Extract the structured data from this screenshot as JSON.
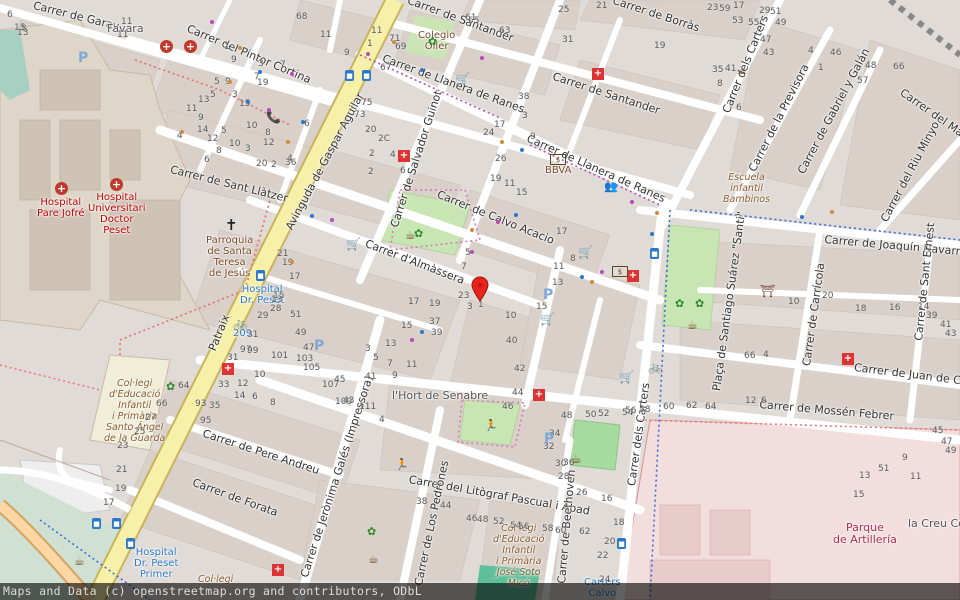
{
  "map": {
    "streets": [
      {
        "id": "garay",
        "name": "Carrer de Garay"
      },
      {
        "id": "pintor",
        "name": "Carrer del Pintor Cortina"
      },
      {
        "id": "gaspar",
        "name": "Avinguda de Gaspar Aguilar"
      },
      {
        "id": "santander1",
        "name": "Carrer de Santander"
      },
      {
        "id": "santander2",
        "name": "Carrer de Santander"
      },
      {
        "id": "borras",
        "name": "Carrer de Borràs"
      },
      {
        "id": "llanera1",
        "name": "Carrer de Llanera de Ranes"
      },
      {
        "id": "llanera2",
        "name": "Carrer de Llanera de Ranes"
      },
      {
        "id": "carters_top",
        "name": "Carrer dels Carters"
      },
      {
        "id": "previsora",
        "name": "Carrer de la Previsora"
      },
      {
        "id": "gabriel",
        "name": "Carrer de Gabriel y Galán"
      },
      {
        "id": "marques",
        "name": "Carrer del Marqu"
      },
      {
        "id": "rumiquel",
        "name": "Carrer del Riu Minyo"
      },
      {
        "id": "llatzer",
        "name": "Carrer de Sant Llàtzer"
      },
      {
        "id": "guinot",
        "name": "Carrer de Salvador Guinot"
      },
      {
        "id": "calvo",
        "name": "Carrer de Calvo Acacio"
      },
      {
        "id": "almassera",
        "name": "Carrer d'Almàssera"
      },
      {
        "id": "joaquin",
        "name": "Carrer de Joaquín Navarro"
      },
      {
        "id": "santiago",
        "name": "Plaça de Santiago Suárez \"Santi\""
      },
      {
        "id": "carricola",
        "name": "Carrer de Carrícola"
      },
      {
        "id": "sant_ernest",
        "name": "Carrer de Sant Ernest"
      },
      {
        "id": "juan",
        "name": "Carrer de Juan de Ce"
      },
      {
        "id": "mossen",
        "name": "Carrer de Mossén Febrer"
      },
      {
        "id": "carters",
        "name": "Carrer dels Carters"
      },
      {
        "id": "pere",
        "name": "Carrer de Pere Andreu"
      },
      {
        "id": "forata",
        "name": "Carrer de Forata"
      },
      {
        "id": "jeronima",
        "name": "Carrer de Jerònima Galés (Impressora)"
      },
      {
        "id": "litograf",
        "name": "Carrer del Litògraf Pascual i Abad"
      },
      {
        "id": "pedrones",
        "name": "Carrer de Los Pedrones"
      },
      {
        "id": "beethoven",
        "name": "Carrer de Beethoven"
      },
      {
        "id": "ramal",
        "name": "Patraix"
      }
    ],
    "places": [
      {
        "id": "favara",
        "text": "Favara",
        "kind": "plain"
      },
      {
        "id": "colegio_oller",
        "text": "Colegio\nOller",
        "kind": "poi"
      },
      {
        "id": "bbva",
        "text": "BBVA",
        "kind": "poi"
      },
      {
        "id": "escuela",
        "text": "Escuela\ninfantil\nBambinos",
        "kind": "school"
      },
      {
        "id": "hosp_jofre",
        "text": "Hospital\nPare Jofré",
        "kind": "hosp"
      },
      {
        "id": "hosp_peset",
        "text": "Hospital\nUniversitari\nDoctor\nPeset",
        "kind": "hosp"
      },
      {
        "id": "parroquia",
        "text": "Parroquia\nde Santa\nTeresa\nde Jesús",
        "kind": "poi"
      },
      {
        "id": "bus_peset",
        "text": "Hospital\nDr. Peset",
        "kind": "bus"
      },
      {
        "id": "bike_209",
        "text": "209",
        "kind": "bus"
      },
      {
        "id": "sant_angel",
        "text": "Col·legi\nd'Educació\nInfantil\ni Primària\nSanto Ángel\nde la Guarda",
        "kind": "school"
      },
      {
        "id": "hort",
        "text": "l'Hort de Senabre",
        "kind": "plain"
      },
      {
        "id": "soto",
        "text": "Col·legi\nd'Educació\nInfantil\ni Primària\nJosé Soto\nMicó",
        "kind": "school"
      },
      {
        "id": "bus_peset2",
        "text": "Hospital\nDr. Peset\nPrimer",
        "kind": "bus"
      },
      {
        "id": "colegi_bottom",
        "text": "Col·legi",
        "kind": "school"
      },
      {
        "id": "bus_carters",
        "text": "Carters\nCalvo",
        "kind": "bus"
      },
      {
        "id": "parque",
        "text": "Parque\nde Artillería",
        "kind": "park"
      },
      {
        "id": "creu",
        "text": "la Creu Co",
        "kind": "plain"
      }
    ],
    "house_numbers": [
      "6",
      "8",
      "11",
      "1",
      "3",
      "5",
      "9",
      "11",
      "69",
      "65",
      "63",
      "61",
      "59",
      "55",
      "53",
      "51",
      "49",
      "47",
      "43",
      "41",
      "35",
      "29",
      "17",
      "23",
      "25",
      "21",
      "31",
      "19",
      "8",
      "6",
      "4",
      "1",
      "46",
      "48",
      "57",
      "66",
      "68",
      "11",
      "9",
      "7",
      "19",
      "15",
      "13",
      "11",
      "9",
      "5",
      "3",
      "20",
      "36",
      "75",
      "73",
      "71",
      "67",
      "38",
      "17",
      "24",
      "26",
      "19",
      "14",
      "12",
      "10",
      "8",
      "6",
      "4",
      "2",
      "6",
      "4",
      "2",
      "12",
      "10",
      "8",
      "6",
      "4",
      "2",
      "20",
      "2C",
      "3",
      "9",
      "11",
      "15",
      "17",
      "8",
      "11",
      "13",
      "15",
      "10",
      "1",
      "3",
      "5",
      "7",
      "23",
      "21",
      "19",
      "17",
      "15",
      "13",
      "28",
      "29",
      "31",
      "31",
      "33",
      "35",
      "93",
      "95",
      "97",
      "99",
      "101",
      "103",
      "105",
      "107",
      "109",
      "111",
      "4",
      "6",
      "8",
      "10",
      "12",
      "14",
      "3",
      "5",
      "7",
      "9",
      "11",
      "13",
      "15",
      "17",
      "19",
      "37",
      "39",
      "41",
      "43",
      "45",
      "47",
      "49",
      "51",
      "40",
      "42",
      "44",
      "46",
      "48",
      "50",
      "52",
      "54",
      "56",
      "58",
      "60",
      "62",
      "64",
      "66",
      "4",
      "6",
      "12",
      "10",
      "20",
      "18",
      "16",
      "14",
      "39",
      "41",
      "43",
      "45",
      "47",
      "49",
      "51",
      "9",
      "11",
      "13",
      "15",
      "16",
      "18",
      "20",
      "22",
      "24",
      "26",
      "28",
      "30",
      "32",
      "34",
      "36",
      "38",
      "44",
      "46",
      "48",
      "52",
      "54",
      "56",
      "58",
      "60",
      "62",
      "64",
      "66",
      "27",
      "25",
      "23",
      "21",
      "19",
      "17",
      "15",
      "13",
      "11",
      "9",
      "7",
      "5",
      "3",
      "1"
    ],
    "attribution": "Maps and Data (c) openstreetmap.org and contributors, ODbL"
  }
}
